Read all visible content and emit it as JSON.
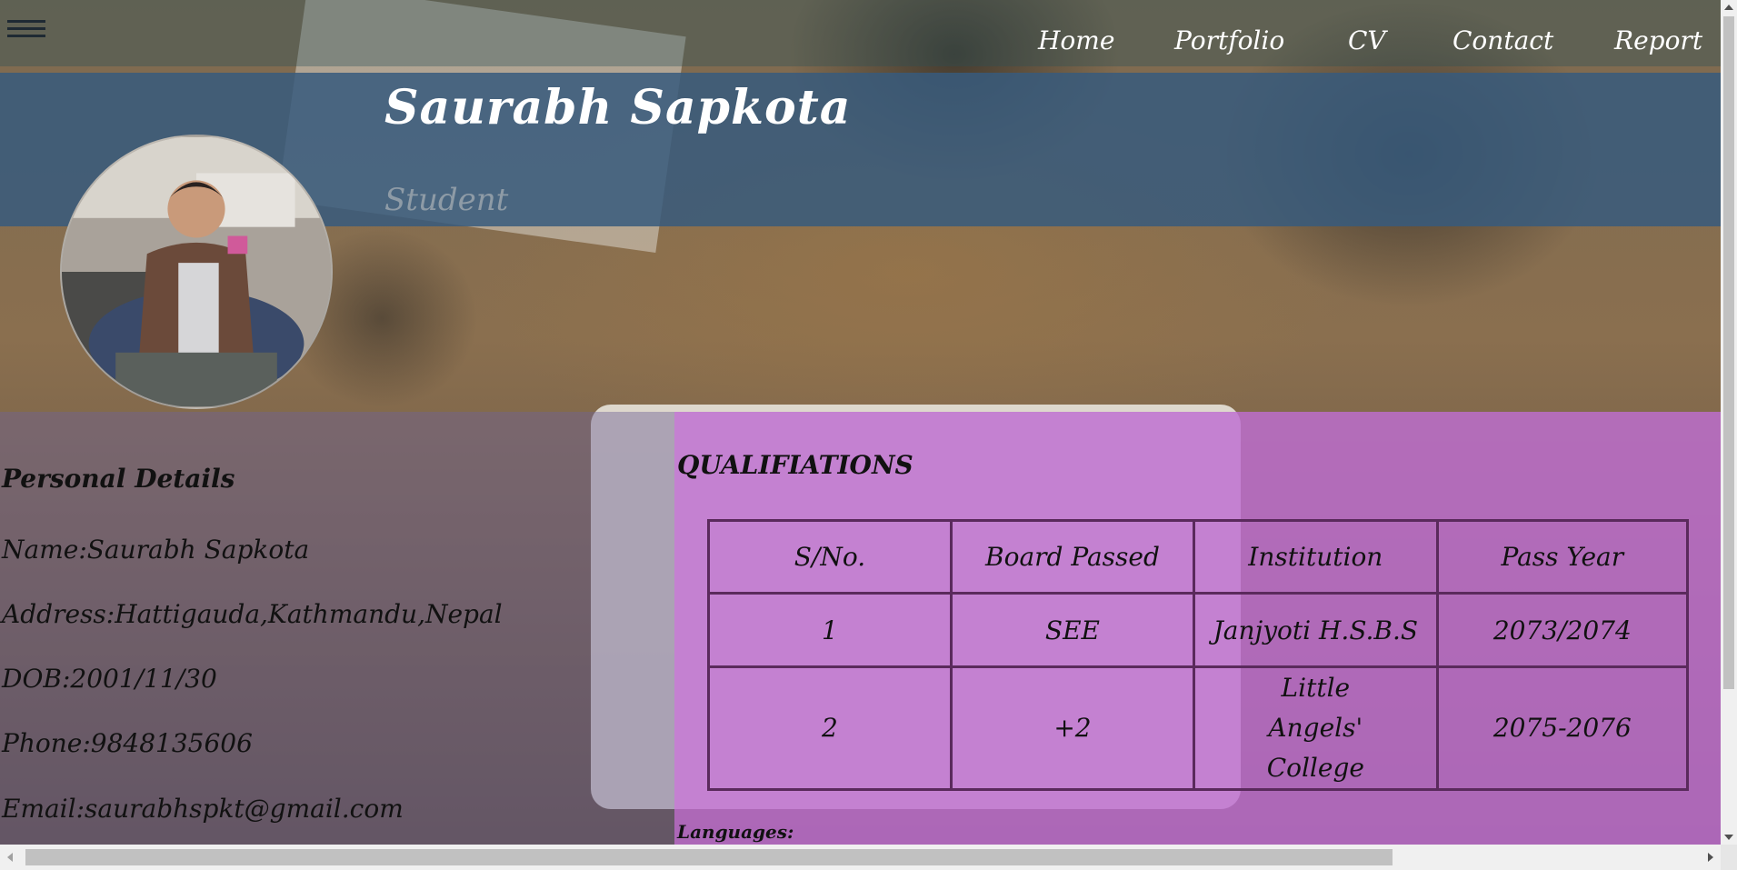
{
  "nav": {
    "links": [
      "Home",
      "Portfolio",
      "CV",
      "Contact",
      "Report"
    ]
  },
  "header": {
    "name": "Saurabh Sapkota",
    "role": "Student"
  },
  "personal": {
    "title": "Personal Details",
    "lines": [
      "Name:Saurabh Sapkota",
      "Address:Hattigauda,Kathmandu,Nepal",
      "DOB:2001/11/30",
      "Phone:9848135606",
      "Email:saurabhspkt@gmail.com"
    ]
  },
  "qualifications": {
    "title": "QUALIFIATIONS",
    "headers": [
      "S/No.",
      "Board Passed",
      "Institution",
      "Pass Year"
    ],
    "rows": [
      [
        "1",
        "SEE",
        "Janjyoti H.S.B.S",
        "2073/2074"
      ],
      [
        "2",
        "+2",
        "Little Angels' College",
        "2075-2076"
      ]
    ]
  },
  "languages": {
    "title": "Languages:"
  },
  "icons": {
    "menu": "hamburger-icon"
  }
}
